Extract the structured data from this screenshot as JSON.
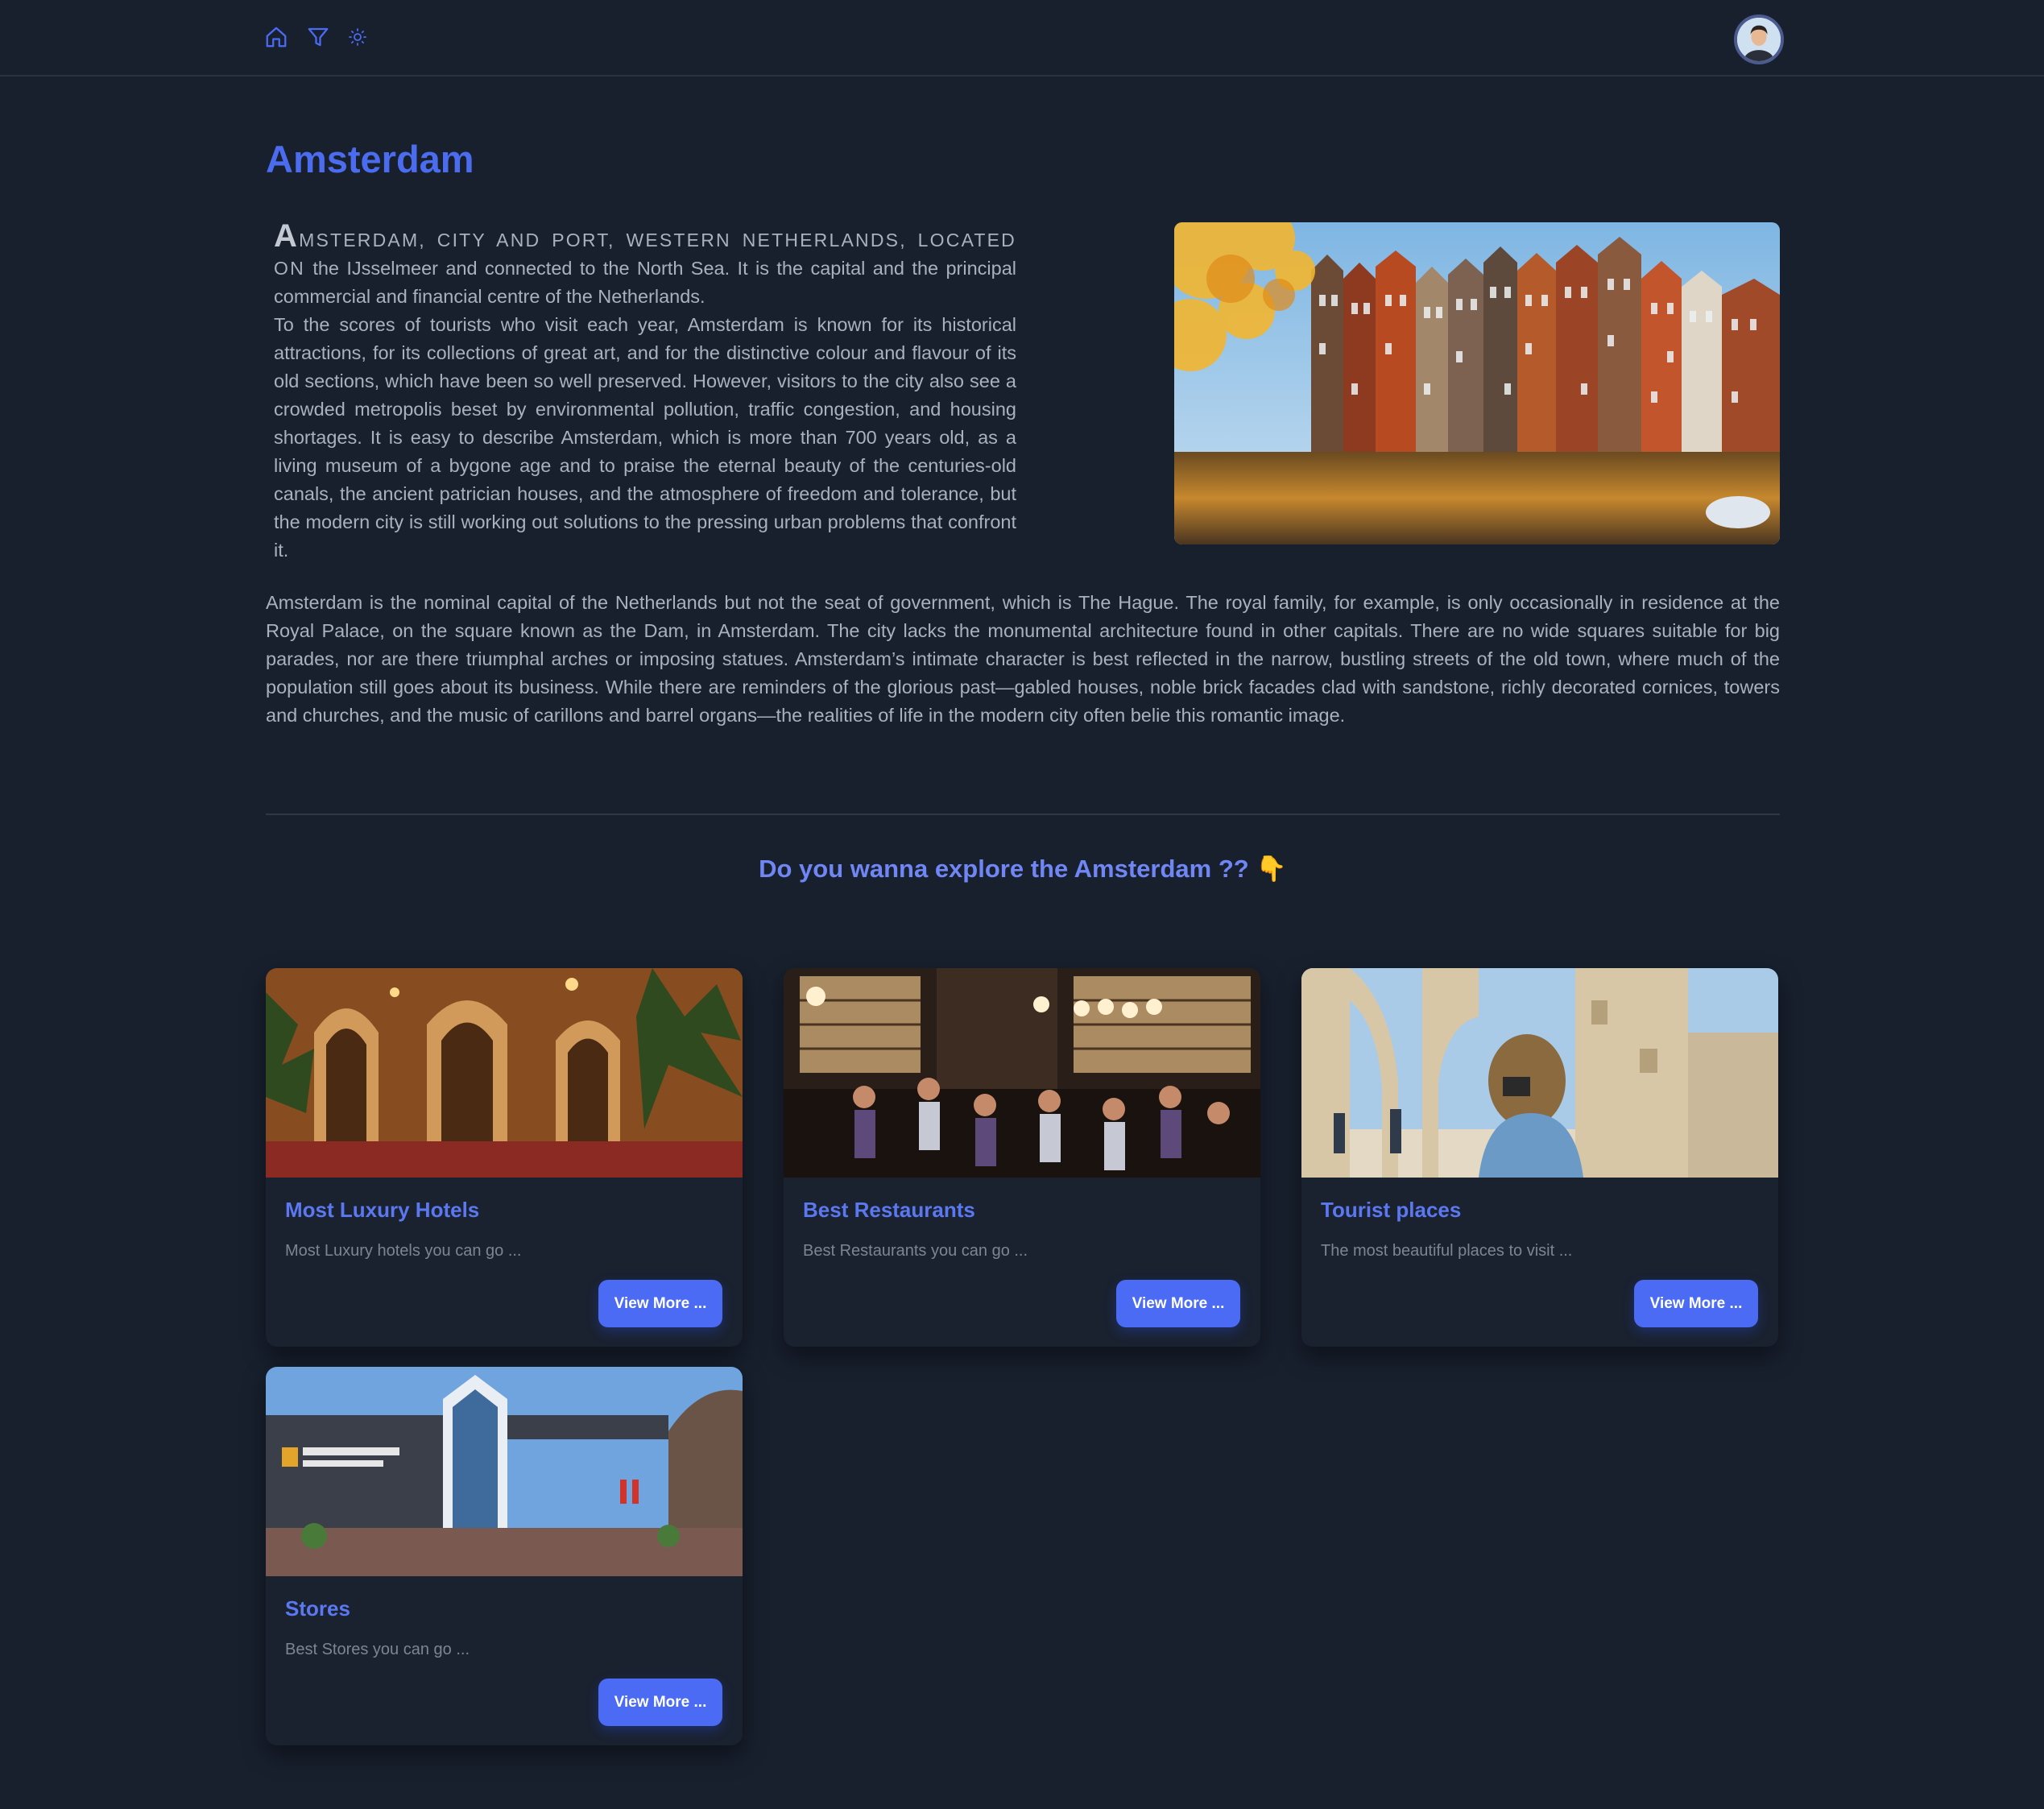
{
  "nav": {
    "icons": [
      "home-icon",
      "filter-icon",
      "sun-icon"
    ],
    "avatar": "user-avatar"
  },
  "page": {
    "title": "Amsterdam"
  },
  "intro": {
    "dropcap": "A",
    "lead": "MSTERDAM, CITY AND PORT, WESTERN NETHERLANDS, LOCATED ON",
    "text1": "the IJsselmeer and connected to the North Sea. It is the capital and the principal commercial and financial centre of the Netherlands.",
    "text2": "To the scores of tourists who visit each year, Amsterdam is known for its historical attractions, for its collections of great art, and for the distinctive colour and flavour of its old sections, which have been so well preserved. However, visitors to the city also see a crowded metropolis beset by environmental pollution, traffic congestion, and housing shortages. It is easy to describe Amsterdam, which is more than 700 years old, as a living museum of a bygone age and to praise the eternal beauty of the centuries-old canals, the ancient patrician houses, and the atmosphere of freedom and tolerance, but the modern city is still working out solutions to the pressing urban problems that confront it."
  },
  "body": {
    "paragraph": "Amsterdam is the nominal capital of the Netherlands but not the seat of government, which is The Hague. The royal family, for example, is only occasionally in residence at the Royal Palace, on the square known as the Dam, in Amsterdam. The city lacks the monumental architecture found in other capitals. There are no wide squares suitable for big parades, nor are there triumphal arches or imposing statues. Amsterdam’s intimate character is best reflected in the narrow, bustling streets of the old town, where much of the population still goes about its business. While there are reminders of the glorious past—gabled houses, noble brick facades clad with sandstone, richly decorated cornices, towers and churches, and the music of carillons and barrel organs—the realities of life in the modern city often belie this romantic image."
  },
  "explore": {
    "heading": "Do you wanna explore the Amsterdam ?? 👇"
  },
  "cards": [
    {
      "title": "Most Luxury Hotels",
      "desc": "Most Luxury hotels you can go ...",
      "button": "View More ..."
    },
    {
      "title": "Best Restaurants",
      "desc": "Best Restaurants you can go ...",
      "button": "View More ..."
    },
    {
      "title": "Tourist places",
      "desc": "The most beautiful places to visit ...",
      "button": "View More ..."
    },
    {
      "title": "Stores",
      "desc": "Best Stores you can go ...",
      "button": "View More ..."
    }
  ],
  "colors": {
    "background": "#18202e",
    "accent": "#4b6bf5",
    "title": "#4c6cf0"
  }
}
